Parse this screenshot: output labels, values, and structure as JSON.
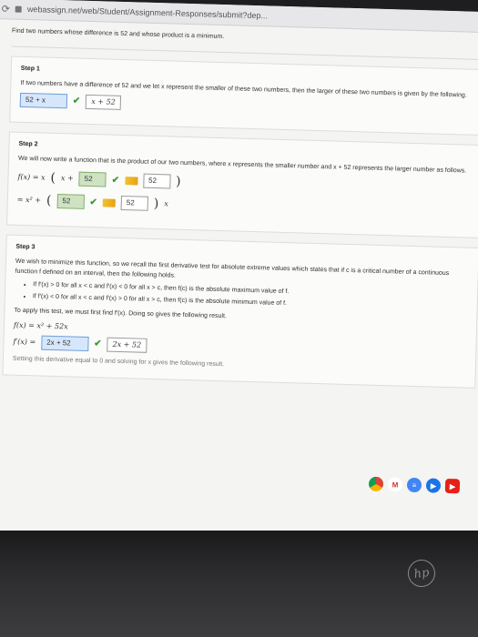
{
  "browser": {
    "url": "webassign.net/web/Student/Assignment-Responses/submit?dep..."
  },
  "problem": {
    "text": "Find two numbers whose difference is 52 and whose product is a minimum."
  },
  "step1": {
    "title": "Step 1",
    "text": "If two numbers have a difference of 52 and we let x represent the smaller of these two numbers, then the larger of these two numbers is given by the following.",
    "answer_value": "52 + x",
    "correct_answer": "x + 52"
  },
  "step2": {
    "title": "Step 2",
    "text": "We will now write a function that is the product of our two numbers, where x represents the smaller number and x + 52 represents the larger number as follows.",
    "line1_prefix": "f(x) = x",
    "line1_inner": "x +",
    "line1_value": "52",
    "line1_hint": "52",
    "line2_prefix": "= x² +",
    "line2_value": "52",
    "line2_hint": "52",
    "line2_suffix": "x"
  },
  "step3": {
    "title": "Step 3",
    "text": "We wish to minimize this function, so we recall the first derivative test for absolute extreme values which states that if c is a critical number of a continuous function f defined on an interval, then the following holds.",
    "bullets": [
      "If f′(x) > 0 for all x < c and f′(x) < 0 for all x > c, then f(c) is the absolute maximum value of f.",
      "If f′(x) < 0 for all x < c and f′(x) > 0 for all x > c, then f(c) is the absolute minimum value of f."
    ],
    "apply_text": "To apply this test, we must first find f′(x). Doing so gives the following result.",
    "fx": "f(x) = x² + 52x",
    "fprime_label": "f′(x) =",
    "fprime_value": "2x + 52",
    "fprime_correct": "2x + 52",
    "cutoff_text": "Setting this derivative equal to 0 and solving for x gives the following result."
  },
  "dock": {
    "icons": [
      "chrome-icon",
      "gmail-icon",
      "docs-icon",
      "meet-icon",
      "youtube-icon"
    ]
  },
  "logo": {
    "text": "hp"
  }
}
